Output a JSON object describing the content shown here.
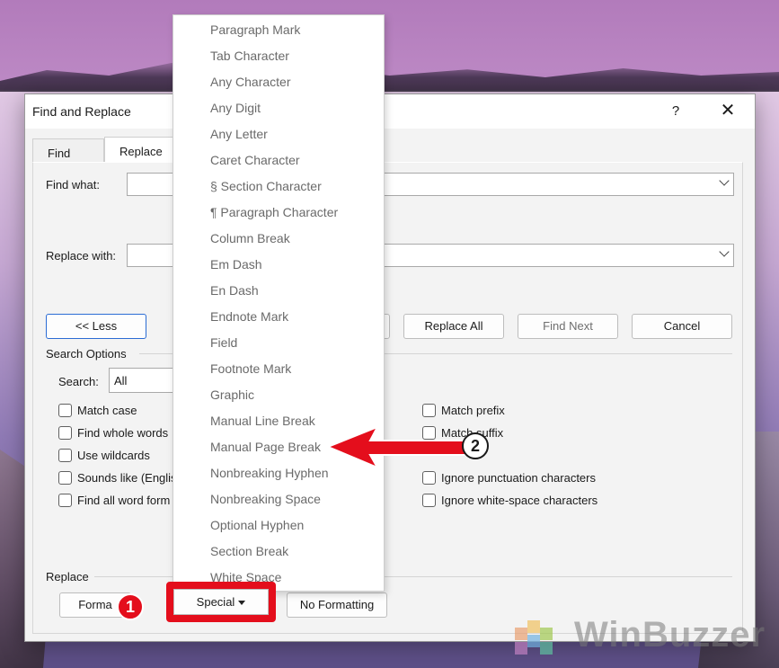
{
  "dialog": {
    "title": "Find and Replace",
    "help": "?",
    "close": "✕",
    "tabs": [
      {
        "label": "Find"
      },
      {
        "label": "Replace"
      }
    ],
    "find_what_label": "Find what:",
    "replace_with_label": "Replace with:",
    "buttons": {
      "less": "<< Less",
      "replace_all": "Replace All",
      "find_next": "Find Next",
      "cancel": "Cancel",
      "format": "Forma",
      "special": "Special",
      "no_formatting": "No Formatting"
    },
    "search_options_label": "Search Options",
    "search_label": "Search:",
    "search_value": "All",
    "left_options": [
      {
        "label": "Match case",
        "checked": false
      },
      {
        "label": "Find whole words",
        "checked": false
      },
      {
        "label": "Use wildcards",
        "checked": false
      },
      {
        "label": "Sounds like (Englis",
        "checked": false
      },
      {
        "label": "Find all word form",
        "checked": false
      }
    ],
    "right_options": [
      {
        "label": "Match prefix",
        "checked": false
      },
      {
        "label": "Match suffix",
        "checked": false
      },
      {
        "label": "Ignore punctuation characters",
        "checked": false
      },
      {
        "label": "Ignore white-space characters",
        "checked": false
      }
    ],
    "replace_section_label": "Replace"
  },
  "special_menu": {
    "items": [
      "Paragraph Mark",
      "Tab Character",
      "Any Character",
      "Any Digit",
      "Any Letter",
      "Caret Character",
      "§ Section Character",
      "¶ Paragraph Character",
      "Column Break",
      "Em Dash",
      "En Dash",
      "Endnote Mark",
      "Field",
      "Footnote Mark",
      "Graphic",
      "Manual Line Break",
      "Manual Page Break",
      "Nonbreaking Hyphen",
      "Nonbreaking Space",
      "Optional Hyphen",
      "Section Break",
      "White Space"
    ]
  },
  "annotations": {
    "step1": "1",
    "step2": "2",
    "highlight_color": "#e40e1c"
  },
  "watermark": {
    "text": "WinBuzzer"
  }
}
